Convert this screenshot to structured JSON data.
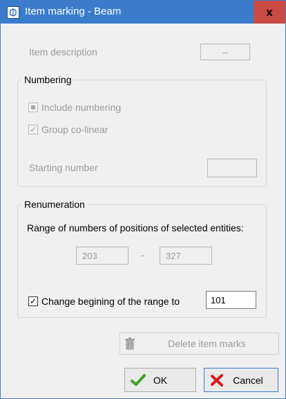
{
  "window": {
    "title": "Item marking - Beam",
    "close_label": "x"
  },
  "item_description": {
    "label": "Item description",
    "value": "--"
  },
  "numbering": {
    "group_title": "Numbering",
    "include_numbering": "Include numbering",
    "group_colinear": "Group co-linear",
    "starting_number_label": "Starting number",
    "starting_number_value": ""
  },
  "renumeration": {
    "group_title": "Renumeration",
    "range_label": "Range of numbers of positions of selected entities:",
    "range_from": "203",
    "range_separator": "-",
    "range_to": "327",
    "change_begin_label": "Change begining of the range to",
    "change_begin_value": "101"
  },
  "buttons": {
    "delete_marks": "Delete item marks",
    "ok": "OK",
    "cancel": "Cancel"
  },
  "colors": {
    "title_bar": "#3a7ccb",
    "close_button": "#c94b43"
  },
  "icons": {
    "title": "app-icon",
    "close": "close-icon",
    "delete": "trash-icon",
    "ok": "checkmark-icon",
    "cancel": "cross-icon"
  }
}
